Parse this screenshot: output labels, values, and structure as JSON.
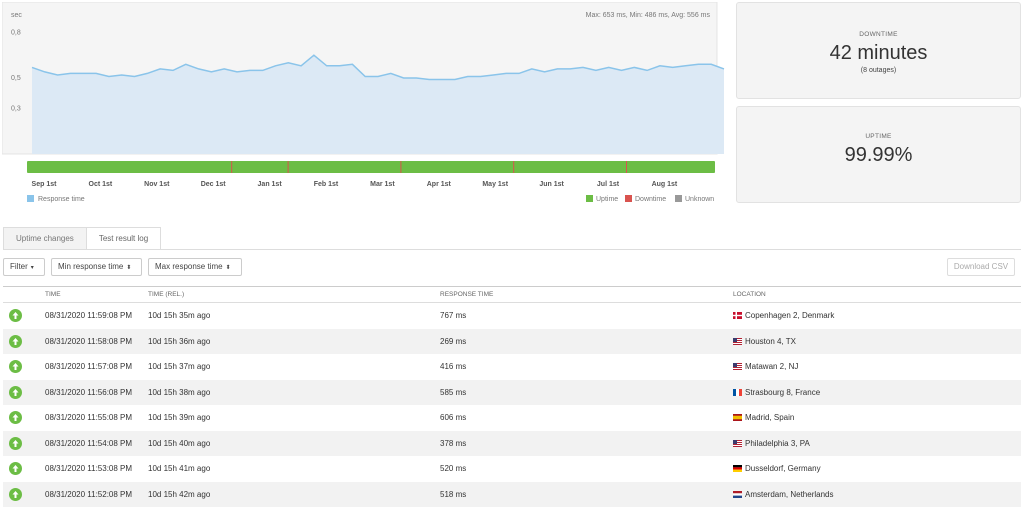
{
  "chart_data": {
    "type": "area",
    "y_unit_label": "sec",
    "stats_text": "Max: 653 ms, Min: 486 ms, Avg: 556 ms",
    "y_ticks": [
      "0,8",
      "0,5",
      "0,3"
    ],
    "y_tick_values": [
      0.8,
      0.5,
      0.3
    ],
    "ylim": [
      0,
      1.0
    ],
    "x_ticks": [
      "Sep 1st",
      "Oct 1st",
      "Nov 1st",
      "Dec 1st",
      "Jan 1st",
      "Feb 1st",
      "Mar 1st",
      "Apr 1st",
      "May 1st",
      "Jun 1st",
      "Jul 1st",
      "Aug 1st"
    ],
    "series": [
      {
        "name": "Response time",
        "color": "#8ac4ea",
        "values": [
          0.57,
          0.54,
          0.52,
          0.53,
          0.53,
          0.53,
          0.51,
          0.52,
          0.51,
          0.53,
          0.56,
          0.55,
          0.59,
          0.56,
          0.54,
          0.56,
          0.54,
          0.55,
          0.55,
          0.58,
          0.6,
          0.58,
          0.65,
          0.58,
          0.58,
          0.59,
          0.51,
          0.51,
          0.53,
          0.5,
          0.5,
          0.49,
          0.49,
          0.49,
          0.51,
          0.51,
          0.52,
          0.53,
          0.53,
          0.56,
          0.54,
          0.56,
          0.56,
          0.57,
          0.55,
          0.57,
          0.55,
          0.57,
          0.55,
          0.58,
          0.57,
          0.58,
          0.59,
          0.59,
          0.56
        ]
      }
    ],
    "status_bar": {
      "uptime_color": "#6cbd45",
      "downtime_color": "#d9534f",
      "outage_months": [
        "Dec 1st",
        "Jan 1st",
        "Mar 1st",
        "May 1st",
        "Jul 1st"
      ]
    },
    "legend": {
      "response": "Response time",
      "uptime": "Uptime",
      "downtime": "Downtime",
      "unknown": "Unknown"
    }
  },
  "downtime": {
    "label": "DOWNTIME",
    "value": "42 minutes",
    "sub": "(8 outages)"
  },
  "uptime": {
    "label": "UPTIME",
    "value": "99.99%"
  },
  "tabs": {
    "uptime_changes": "Uptime changes",
    "test_result_log": "Test result log"
  },
  "filters": {
    "filter": "Filter",
    "min_response": "Min response time",
    "max_response": "Max response time",
    "download_csv": "Download CSV"
  },
  "table": {
    "headers": {
      "time": "TIME",
      "time_rel": "TIME (REL.)",
      "response_time": "RESPONSE TIME",
      "location": "LOCATION"
    },
    "rows": [
      {
        "time": "08/31/2020 11:59:08 PM",
        "rel": "10d 15h 35m ago",
        "response": "767 ms",
        "location": "Copenhagen 2, Denmark",
        "flag": "dk"
      },
      {
        "time": "08/31/2020 11:58:08 PM",
        "rel": "10d 15h 36m ago",
        "response": "269 ms",
        "location": "Houston 4, TX",
        "flag": "us"
      },
      {
        "time": "08/31/2020 11:57:08 PM",
        "rel": "10d 15h 37m ago",
        "response": "416 ms",
        "location": "Matawan 2, NJ",
        "flag": "us"
      },
      {
        "time": "08/31/2020 11:56:08 PM",
        "rel": "10d 15h 38m ago",
        "response": "585 ms",
        "location": "Strasbourg 8, France",
        "flag": "fr"
      },
      {
        "time": "08/31/2020 11:55:08 PM",
        "rel": "10d 15h 39m ago",
        "response": "606 ms",
        "location": "Madrid, Spain",
        "flag": "es"
      },
      {
        "time": "08/31/2020 11:54:08 PM",
        "rel": "10d 15h 40m ago",
        "response": "378 ms",
        "location": "Philadelphia 3, PA",
        "flag": "us"
      },
      {
        "time": "08/31/2020 11:53:08 PM",
        "rel": "10d 15h 41m ago",
        "response": "520 ms",
        "location": "Dusseldorf, Germany",
        "flag": "de"
      },
      {
        "time": "08/31/2020 11:52:08 PM",
        "rel": "10d 15h 42m ago",
        "response": "518 ms",
        "location": "Amsterdam, Netherlands",
        "flag": "nl"
      }
    ]
  }
}
